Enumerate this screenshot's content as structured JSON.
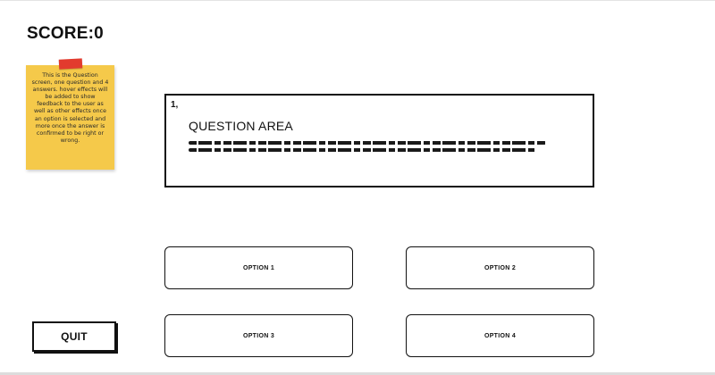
{
  "header": {
    "score_label": "SCORE:0"
  },
  "sticky_note": {
    "text": "This is the Question screen, one question and 4 answers. hover effects will be added to show feedback to the user as well as other effects once an option is selected and more once the answer is confirmed to be right or wrong.",
    "tape_color": "#e23b2e",
    "note_color": "#f5c94a"
  },
  "question": {
    "number": "1,",
    "title": "QUESTION AREA"
  },
  "options": [
    {
      "label": "OPTION 1"
    },
    {
      "label": "OPTION 2"
    },
    {
      "label": "OPTION 3"
    },
    {
      "label": "OPTION 4"
    }
  ],
  "quit": {
    "label": "QUIT"
  }
}
